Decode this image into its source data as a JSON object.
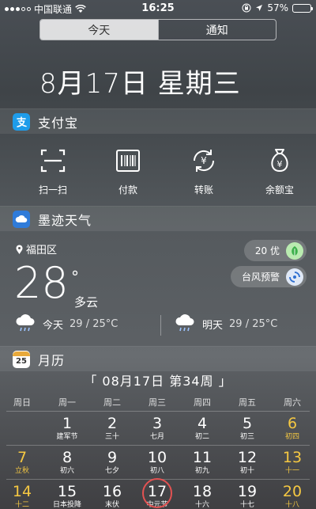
{
  "status_bar": {
    "carrier": "中国联通",
    "time": "16:25",
    "battery": "57%",
    "battery_level": 0.57
  },
  "tabs": [
    {
      "label": "今天",
      "active": true
    },
    {
      "label": "通知",
      "active": false
    }
  ],
  "date_title": "8月17日 星期三",
  "alipay": {
    "title": "支付宝",
    "icon": "alipay-icon",
    "actions": [
      {
        "label": "扫一扫",
        "icon": "scan-icon"
      },
      {
        "label": "付款",
        "icon": "barcode-icon"
      },
      {
        "label": "转账",
        "icon": "transfer-yuan-icon"
      },
      {
        "label": "余额宝",
        "icon": "money-bag-icon"
      }
    ]
  },
  "weather": {
    "title": "墨迹天气",
    "location": "福田区",
    "temperature": "28",
    "degree_symbol": "°",
    "condition": "多云",
    "aqi_label": "20 优",
    "alert_label": "台风预警",
    "today": {
      "label": "今天",
      "range": "29 / 25°C"
    },
    "tomorrow": {
      "label": "明天",
      "range": "29 / 25°C"
    }
  },
  "calendar": {
    "title": "月历",
    "icon_text": "25",
    "header": "「 08月17日 第34周 」",
    "weekdays": [
      "周日",
      "周一",
      "周二",
      "周三",
      "周四",
      "周五",
      "周六"
    ],
    "weeks": [
      [
        {
          "num": "",
          "sub": ""
        },
        {
          "num": "1",
          "sub": "建军节"
        },
        {
          "num": "2",
          "sub": "三十"
        },
        {
          "num": "3",
          "sub": "七月"
        },
        {
          "num": "4",
          "sub": "初二"
        },
        {
          "num": "5",
          "sub": "初三"
        },
        {
          "num": "6",
          "sub": "初四"
        }
      ],
      [
        {
          "num": "7",
          "sub": "立秋"
        },
        {
          "num": "8",
          "sub": "初六"
        },
        {
          "num": "9",
          "sub": "七夕"
        },
        {
          "num": "10",
          "sub": "初八"
        },
        {
          "num": "11",
          "sub": "初九"
        },
        {
          "num": "12",
          "sub": "初十"
        },
        {
          "num": "13",
          "sub": "十一"
        }
      ],
      [
        {
          "num": "14",
          "sub": "十二"
        },
        {
          "num": "15",
          "sub": "日本投降"
        },
        {
          "num": "16",
          "sub": "末伏"
        },
        {
          "num": "17",
          "sub": "中元节",
          "today": true
        },
        {
          "num": "18",
          "sub": "十六"
        },
        {
          "num": "19",
          "sub": "十七"
        },
        {
          "num": "20",
          "sub": "十八"
        }
      ]
    ],
    "weekend_color": "#f5c842",
    "today_ring_color": "#e35252"
  }
}
